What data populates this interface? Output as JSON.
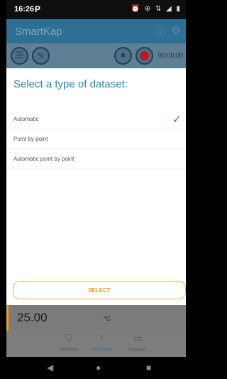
{
  "status_bar": {
    "time": "16:26",
    "app_icon": "P",
    "right_icons": "alarm-icon vibrate-icon data-icon signal-icon battery-icon",
    "right_glyphs": "⏰ ⊕ ⇅ ◢ ▮"
  },
  "app_bar": {
    "title": "SmartKap",
    "icons": [
      "info-icon",
      "gear-icon"
    ]
  },
  "toolbar": {
    "timer": "00:00:00",
    "buttons": [
      "list-icon",
      "sine-wave-icon",
      "pause-icon",
      "record-icon"
    ]
  },
  "dialog": {
    "title": "Select a type of dataset:",
    "options": [
      {
        "label": "Automatic",
        "selected": true
      },
      {
        "label": "Point by point",
        "selected": false
      },
      {
        "label": "Automatic point by point",
        "selected": false
      }
    ],
    "select_label": "SELECT"
  },
  "reading": {
    "value": "25.00",
    "unit": "°C",
    "accent": "#e9a420"
  },
  "bottom_nav": {
    "tabs": [
      {
        "label": "Balometer",
        "icon": "cup-icon",
        "active": false
      },
      {
        "label": "Manometer",
        "icon": "chart-icon",
        "active": true
      },
      {
        "label": "Datasets",
        "icon": "folder-icon",
        "active": false
      }
    ]
  },
  "colors": {
    "app_bar": "#2e6f96",
    "accent_blue": "#2b87b2",
    "select_orange": "#e79a1b",
    "record_red": "#b81a25"
  }
}
